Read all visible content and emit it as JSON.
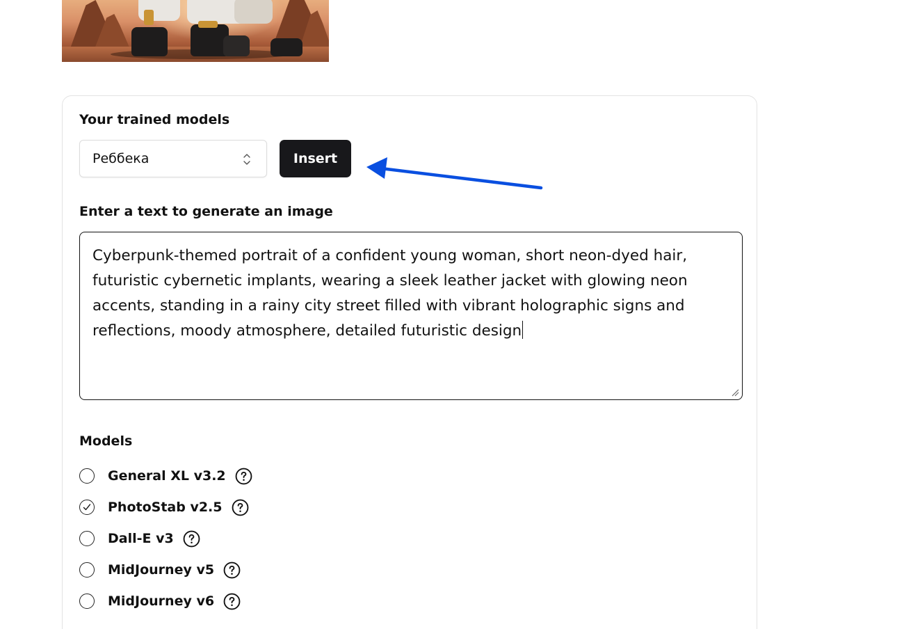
{
  "trained_models": {
    "label": "Your trained models",
    "selected": "Реббека",
    "insert_label": "Insert"
  },
  "prompt": {
    "label": "Enter a text to generate an image",
    "value": "Cyberpunk-themed portrait of a confident young woman, short neon-dyed hair, futuristic cybernetic implants, wearing a sleek leather jacket with glowing neon accents, standing in a rainy city street filled with vibrant holographic signs and reflections, moody atmosphere, detailed futuristic design"
  },
  "models": {
    "label": "Models",
    "options": [
      {
        "label": "General XL v3.2",
        "selected": false
      },
      {
        "label": "PhotoStab v2.5",
        "selected": true
      },
      {
        "label": "Dall-E v3",
        "selected": false
      },
      {
        "label": "MidJourney v5",
        "selected": false
      },
      {
        "label": "MidJourney v6",
        "selected": false
      }
    ]
  },
  "icons": {
    "select": "chevron-up-down-icon",
    "help": "question-circle-icon",
    "annotation": "arrow-icon"
  },
  "colors": {
    "button_bg": "#18181b",
    "annotation_arrow": "#0a4fe0"
  }
}
